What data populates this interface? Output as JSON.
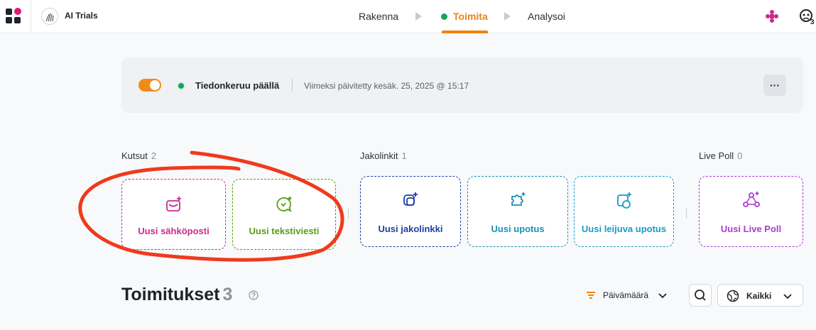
{
  "app": {
    "project_name": "AI Trials",
    "user_count": "3"
  },
  "nav": {
    "steps": [
      {
        "label": "Rakenna",
        "active": false
      },
      {
        "label": "Toimita",
        "active": true
      },
      {
        "label": "Analysoi",
        "active": false
      }
    ]
  },
  "status": {
    "toggle_on": true,
    "text": "Tiedonkeruu päällä",
    "last_updated": "Viimeksi päivitetty kesäk. 25, 2025 @ 15:17",
    "more_label": "···"
  },
  "groups": [
    {
      "title": "Kutsut",
      "count": "2",
      "cards": [
        {
          "label": "Uusi sähköposti",
          "icon": "email-add-icon",
          "color": "#cc2a8f"
        },
        {
          "label": "Uusi tekstiviesti",
          "icon": "sms-add-icon",
          "color": "#5a9e12"
        }
      ]
    },
    {
      "title": "Jakolinkit",
      "count": "1",
      "cards": [
        {
          "label": "Uusi jakolinkki",
          "icon": "link-add-icon",
          "color": "#1d3fa8"
        },
        {
          "label": "Uusi upotus",
          "icon": "embed-add-icon",
          "color": "#1a8fb5"
        },
        {
          "label": "Uusi leijuva upotus",
          "icon": "floating-embed-add-icon",
          "color": "#1a9bc7"
        }
      ]
    },
    {
      "title": "Live Poll",
      "count": "0",
      "cards": [
        {
          "label": "Uusi Live Poll",
          "icon": "live-poll-add-icon",
          "color": "#a93ad6"
        }
      ]
    }
  ],
  "deliveries": {
    "title": "Toimitukset",
    "count": "3",
    "sort_label": "Päivämäärä",
    "filter_label": "Kaikki"
  },
  "colors": {
    "accent": "#f0820f",
    "success": "#16a35a",
    "annotation": "#f03a1c"
  }
}
